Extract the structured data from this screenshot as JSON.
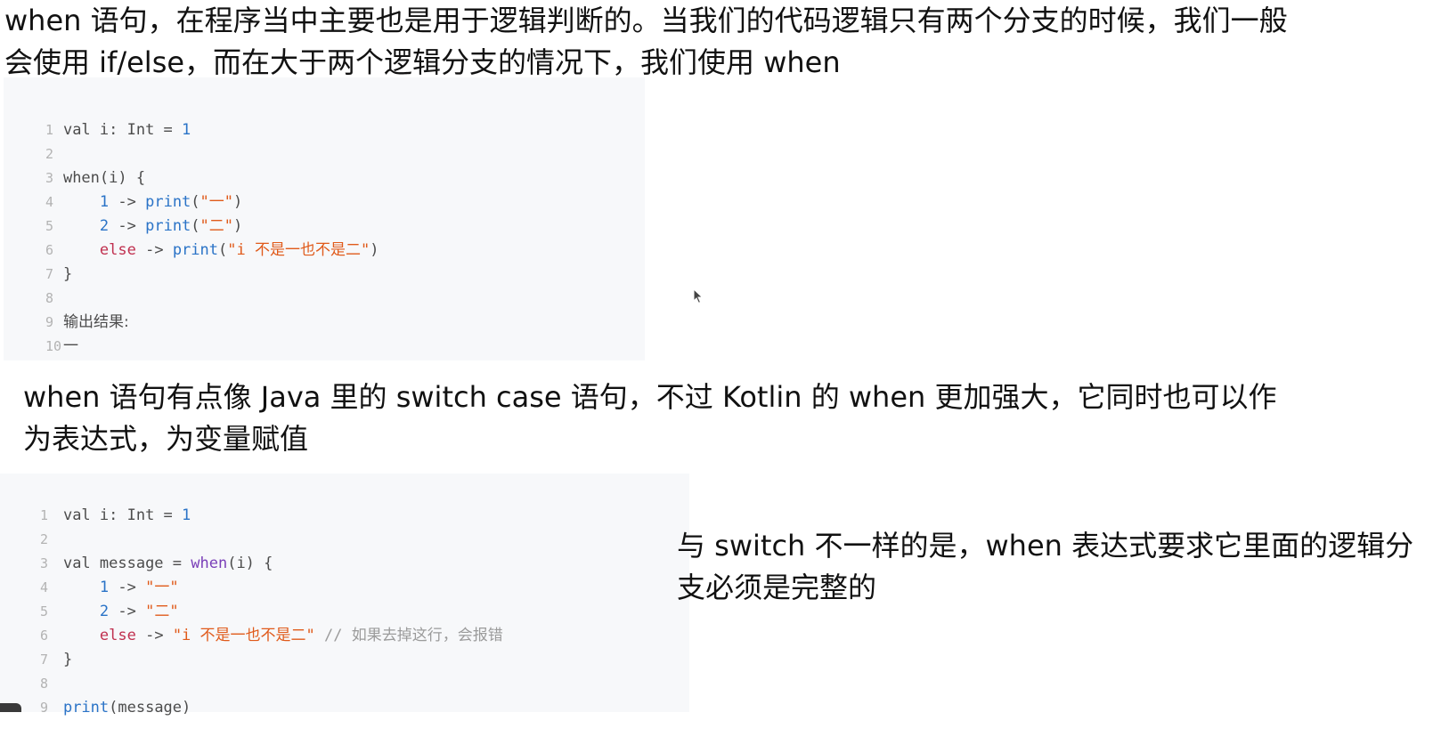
{
  "intro": {
    "line1": "when 语句，在程序当中主要也是用于逻辑判断的。当我们的代码逻辑只有两个分支的时候，我们一般",
    "line2": "会使用 if/else，而在大于两个逻辑分支的情况下，我们使用 when"
  },
  "code1": {
    "lines": [
      {
        "num": "1",
        "parts": [
          "val i: Int = ",
          "1"
        ]
      },
      {
        "num": "2"
      },
      {
        "num": "3",
        "parts": [
          "when(i) {"
        ]
      },
      {
        "num": "4",
        "parts": [
          "    ",
          "1",
          " -> ",
          "print",
          "(",
          "\"一\"",
          ")"
        ]
      },
      {
        "num": "5",
        "parts": [
          "    ",
          "2",
          " -> ",
          "print",
          "(",
          "\"二\"",
          ")"
        ]
      },
      {
        "num": "6",
        "parts": [
          "    ",
          "else",
          " -> ",
          "print",
          "(",
          "\"i 不是一也不是二\"",
          ")"
        ]
      },
      {
        "num": "7",
        "parts": [
          "}"
        ]
      },
      {
        "num": "8"
      },
      {
        "num": "9",
        "parts": [
          "输出结果:"
        ]
      },
      {
        "num": "10",
        "parts": [
          "一"
        ]
      }
    ]
  },
  "mid": {
    "line1": "when 语句有点像 Java 里的 switch case 语句，不过 Kotlin 的 when 更加强大，它同时也可以作",
    "line2": "为表达式，为变量赋值"
  },
  "side": {
    "line1": "与 switch 不一样的是，when 表达式要求它里面的逻辑分",
    "line2": "支必须是完整的"
  },
  "code2": {
    "lines": [
      {
        "num": "1",
        "parts": [
          "val i: Int = ",
          "1"
        ]
      },
      {
        "num": "2"
      },
      {
        "num": "3",
        "parts": [
          "val message = ",
          "when",
          "(i) {"
        ]
      },
      {
        "num": "4",
        "parts": [
          "    ",
          "1",
          " -> ",
          "\"一\""
        ]
      },
      {
        "num": "5",
        "parts": [
          "    ",
          "2",
          " -> ",
          "\"二\""
        ]
      },
      {
        "num": "6",
        "parts": [
          "    ",
          "else",
          " -> ",
          "\"i 不是一也不是二\"",
          " // 如果去掉这行，会报错"
        ]
      },
      {
        "num": "7",
        "parts": [
          "}"
        ]
      },
      {
        "num": "8"
      },
      {
        "num": "9",
        "parts": [
          "print",
          "(message)"
        ]
      }
    ]
  }
}
